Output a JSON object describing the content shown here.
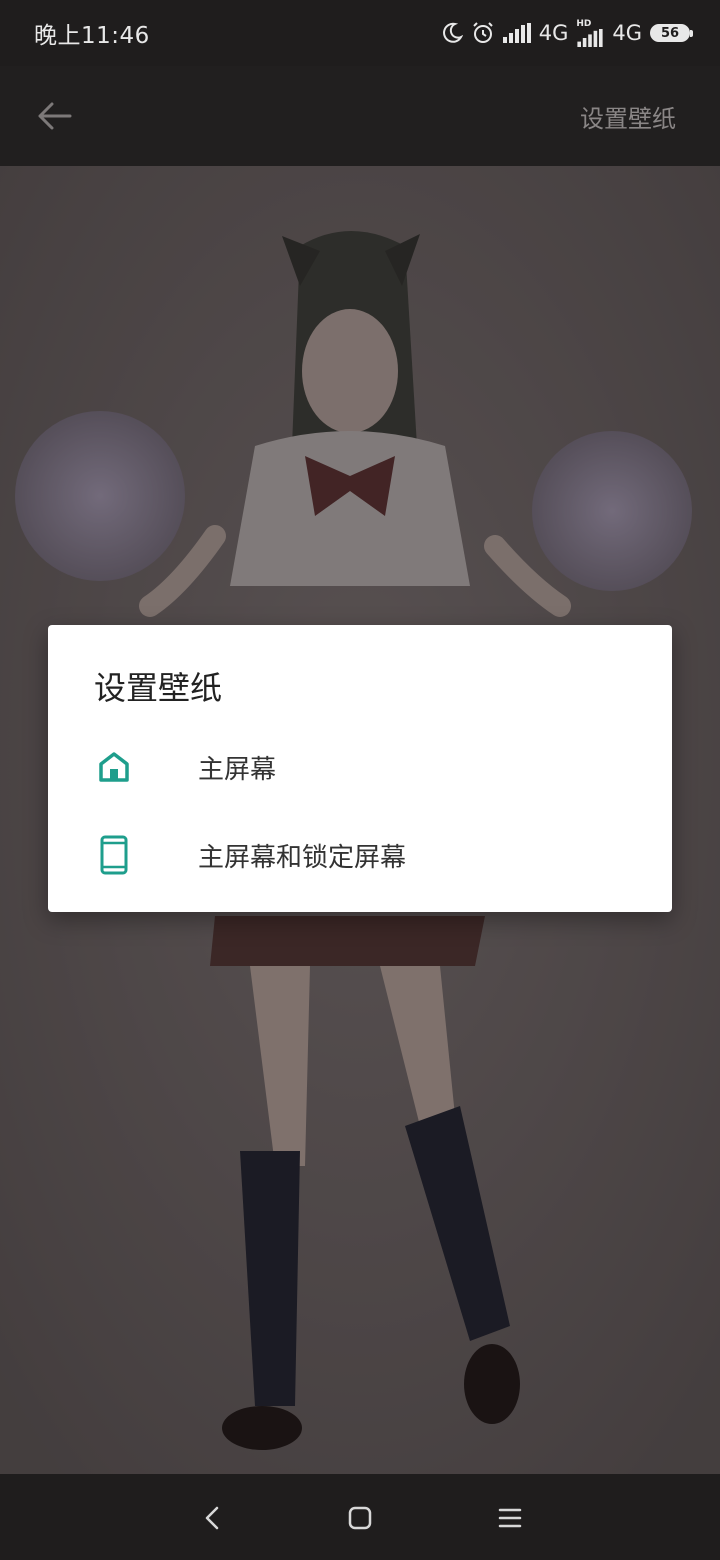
{
  "status_bar": {
    "time": "晚上11:46",
    "network_1": "4G",
    "network_2": "4G",
    "hd_label": "HD",
    "battery": "56",
    "icons": [
      "moon-icon",
      "alarm-icon",
      "signal-icon",
      "signal-icon"
    ]
  },
  "app_bar": {
    "action_label": "设置壁纸",
    "back_icon": "arrow-left-icon"
  },
  "dialog": {
    "title": "设置壁纸",
    "options": [
      {
        "icon": "home-icon",
        "label": "主屏幕"
      },
      {
        "icon": "phone-icon",
        "label": "主屏幕和锁定屏幕"
      }
    ],
    "accent_color": "#1e9e8c"
  },
  "nav_bar": {
    "icons": [
      "back-triangle-icon",
      "home-square-icon",
      "menu-icon"
    ]
  }
}
